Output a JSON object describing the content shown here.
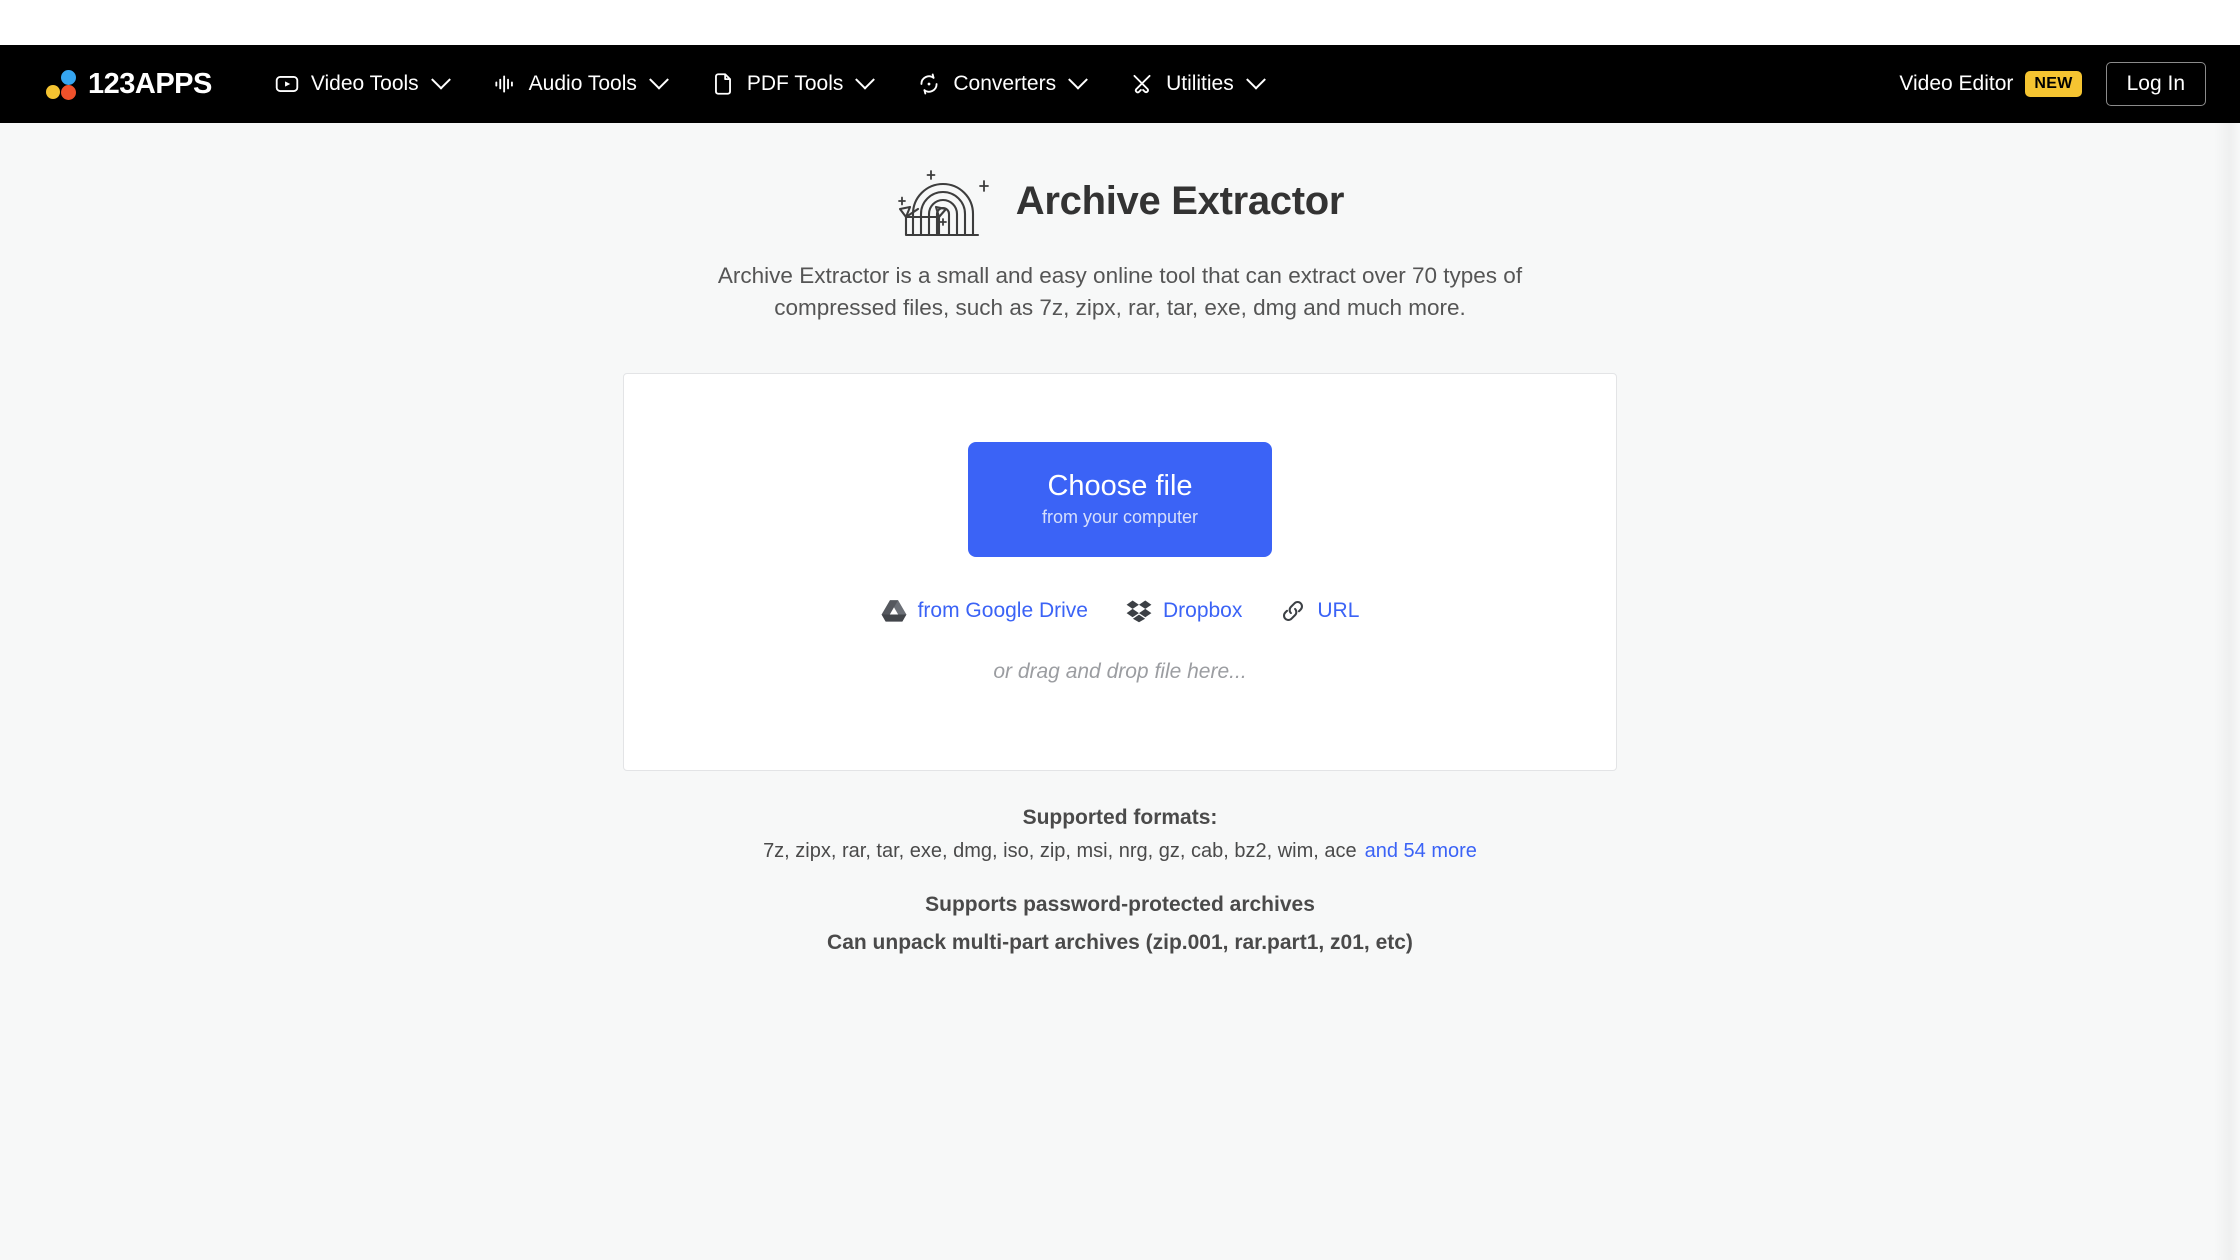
{
  "header": {
    "logo": {
      "text": "123APPS",
      "dot_colors": [
        "#35a5f0",
        "#f5c431",
        "#f0512b"
      ]
    },
    "nav": [
      {
        "label": "Video Tools",
        "icon": "video-play-icon",
        "has_caret": true
      },
      {
        "label": "Audio Tools",
        "icon": "audio-waveform-icon",
        "has_caret": true
      },
      {
        "label": "PDF Tools",
        "icon": "document-page-icon",
        "has_caret": true
      },
      {
        "label": "Converters",
        "icon": "convert-refresh-icon",
        "has_caret": true
      },
      {
        "label": "Utilities",
        "icon": "tools-cross-icon",
        "has_caret": true
      }
    ],
    "video_editor_label": "Video Editor",
    "video_editor_badge": "NEW",
    "login_label": "Log In",
    "background_color": "#000000",
    "badge_color": "#f5c431"
  },
  "main": {
    "title": "Archive Extractor",
    "title_icon": "rainbow-box-icon",
    "subtitle": "Archive Extractor is a small and easy online tool that can extract over 70 types of compressed files, such as 7z, zipx, rar, tar, exe, dmg and much more.",
    "upload": {
      "choose_file_label": "Choose file",
      "choose_file_sublabel": "from your computer",
      "button_color": "#3b63f6",
      "sources": [
        {
          "label": "from Google Drive",
          "icon": "google-drive-icon"
        },
        {
          "label": "Dropbox",
          "icon": "dropbox-icon"
        },
        {
          "label": "URL",
          "icon": "link-chain-icon"
        }
      ],
      "drag_hint": "or drag and drop file here..."
    },
    "notes": {
      "supported_formats_title": "Supported formats:",
      "formats_list": "7z, zipx, rar, tar, exe, dmg, iso, zip, msi, nrg, gz, cab, bz2, wim, ace",
      "formats_more_link": "and 54 more",
      "password_note": "Supports password-protected archives",
      "multipart_note": "Can unpack multi-part archives (zip.001, rar.part1, z01, etc)"
    }
  }
}
